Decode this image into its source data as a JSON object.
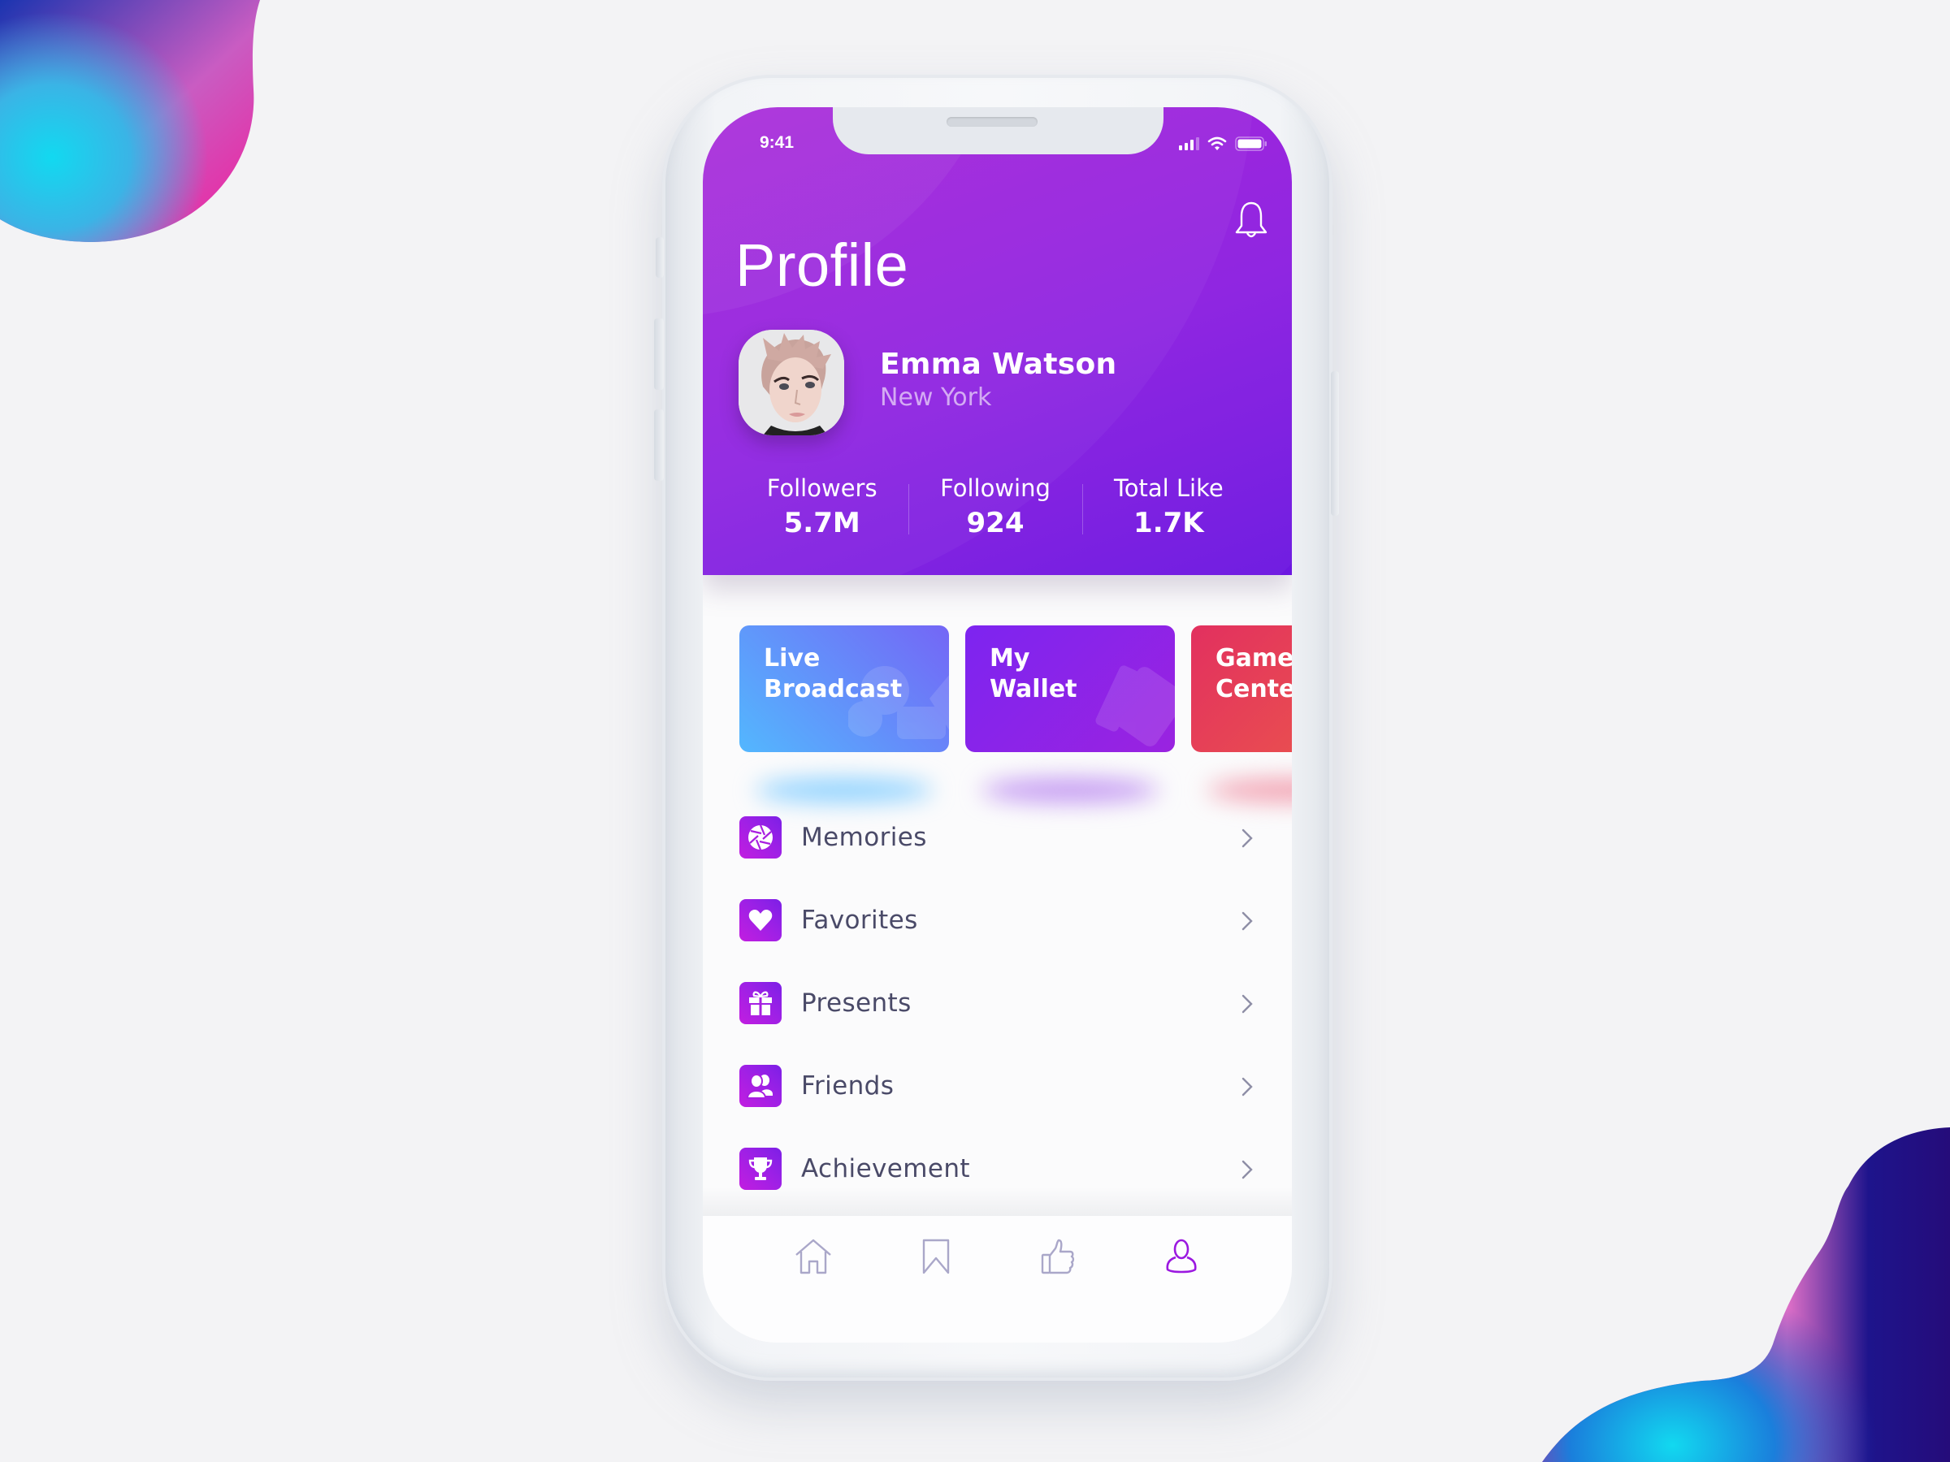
{
  "status_bar": {
    "time": "9:41",
    "icons": [
      "signal-icon",
      "wifi-icon",
      "battery-icon"
    ]
  },
  "header": {
    "title": "Profile",
    "notification_icon": "bell-icon"
  },
  "user": {
    "name": "Emma Watson",
    "location": "New York",
    "avatar": "profile-photo"
  },
  "stats": [
    {
      "label": "Followers",
      "value": "5.7M"
    },
    {
      "label": "Following",
      "value": "924"
    },
    {
      "label": "Total Like",
      "value": "1.7K"
    }
  ],
  "quick_cards": [
    {
      "label": "Live\nBroadcast",
      "icon": "broadcast-icon",
      "colors": [
        "#53b7fe",
        "#7466f6"
      ]
    },
    {
      "label": "My\nWallet",
      "icon": "wallet-icon",
      "colors": [
        "#7d24f0",
        "#9a23e0"
      ]
    },
    {
      "label": "Game\nCenter",
      "icon": "game-icon",
      "colors": [
        "#e2305f",
        "#ec5a4a"
      ]
    }
  ],
  "menu": [
    {
      "label": "Memories",
      "icon": "aperture-icon"
    },
    {
      "label": "Favorites",
      "icon": "heart-icon"
    },
    {
      "label": "Presents",
      "icon": "gift-icon"
    },
    {
      "label": "Friends",
      "icon": "friends-icon"
    },
    {
      "label": "Achievement",
      "icon": "trophy-icon"
    }
  ],
  "tabbar": {
    "items": [
      {
        "name": "home",
        "icon": "home-icon",
        "active": false
      },
      {
        "name": "bookmarks",
        "icon": "bookmark-icon",
        "active": false
      },
      {
        "name": "likes",
        "icon": "thumbs-up-icon",
        "active": false
      },
      {
        "name": "profile",
        "icon": "user-icon",
        "active": true
      }
    ]
  },
  "colors": {
    "header_start": "#a620d8",
    "header_end": "#6c17e0",
    "accent": "#9a1fe0",
    "text_dark": "#4a4a68",
    "tab_inactive": "#a9a6c8",
    "tab_active": "#9b18e0"
  }
}
